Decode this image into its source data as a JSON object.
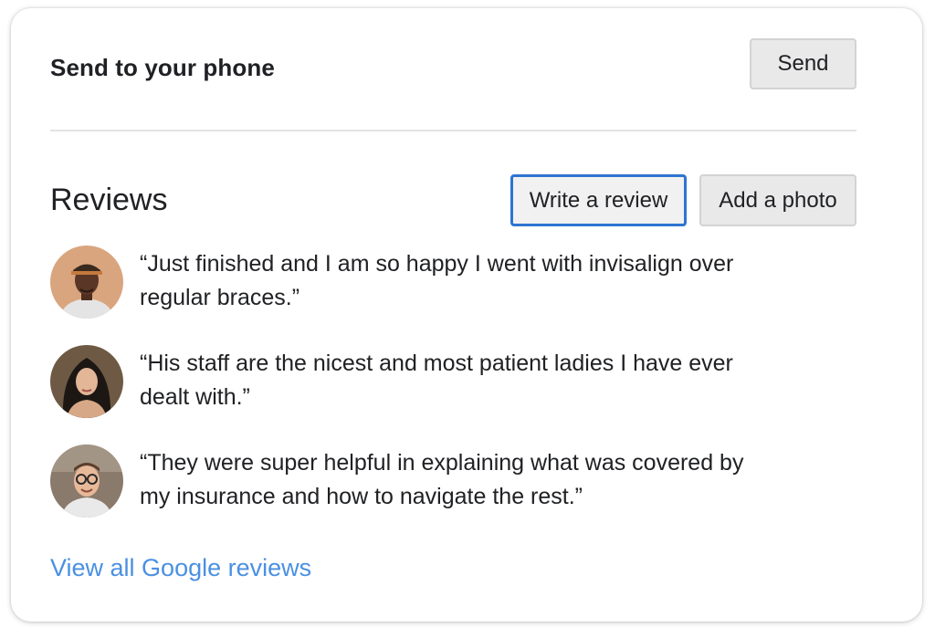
{
  "send_section": {
    "title": "Send to your phone",
    "send_button_label": "Send"
  },
  "reviews_section": {
    "title": "Reviews",
    "write_review_label": "Write a review",
    "add_photo_label": "Add a photo",
    "items": [
      {
        "quote_line1": "“Just finished and I am so happy I went with invisalign over",
        "quote_line2": "regular braces.”",
        "avatar_icon": "reviewer-avatar-1"
      },
      {
        "quote_line1": "“His staff are the nicest and most patient ladies I have ever",
        "quote_line2": "dealt with.”",
        "avatar_icon": "reviewer-avatar-2"
      },
      {
        "quote_line1": "“They were super helpful in explaining what was covered by",
        "quote_line2": "my insurance and how to navigate the rest.”",
        "avatar_icon": "reviewer-avatar-3"
      }
    ],
    "view_all_label": "View all Google reviews"
  },
  "colors": {
    "link": "#4a90e2",
    "focus_border": "#2e74d1",
    "button_bg": "#e9e9e9"
  }
}
